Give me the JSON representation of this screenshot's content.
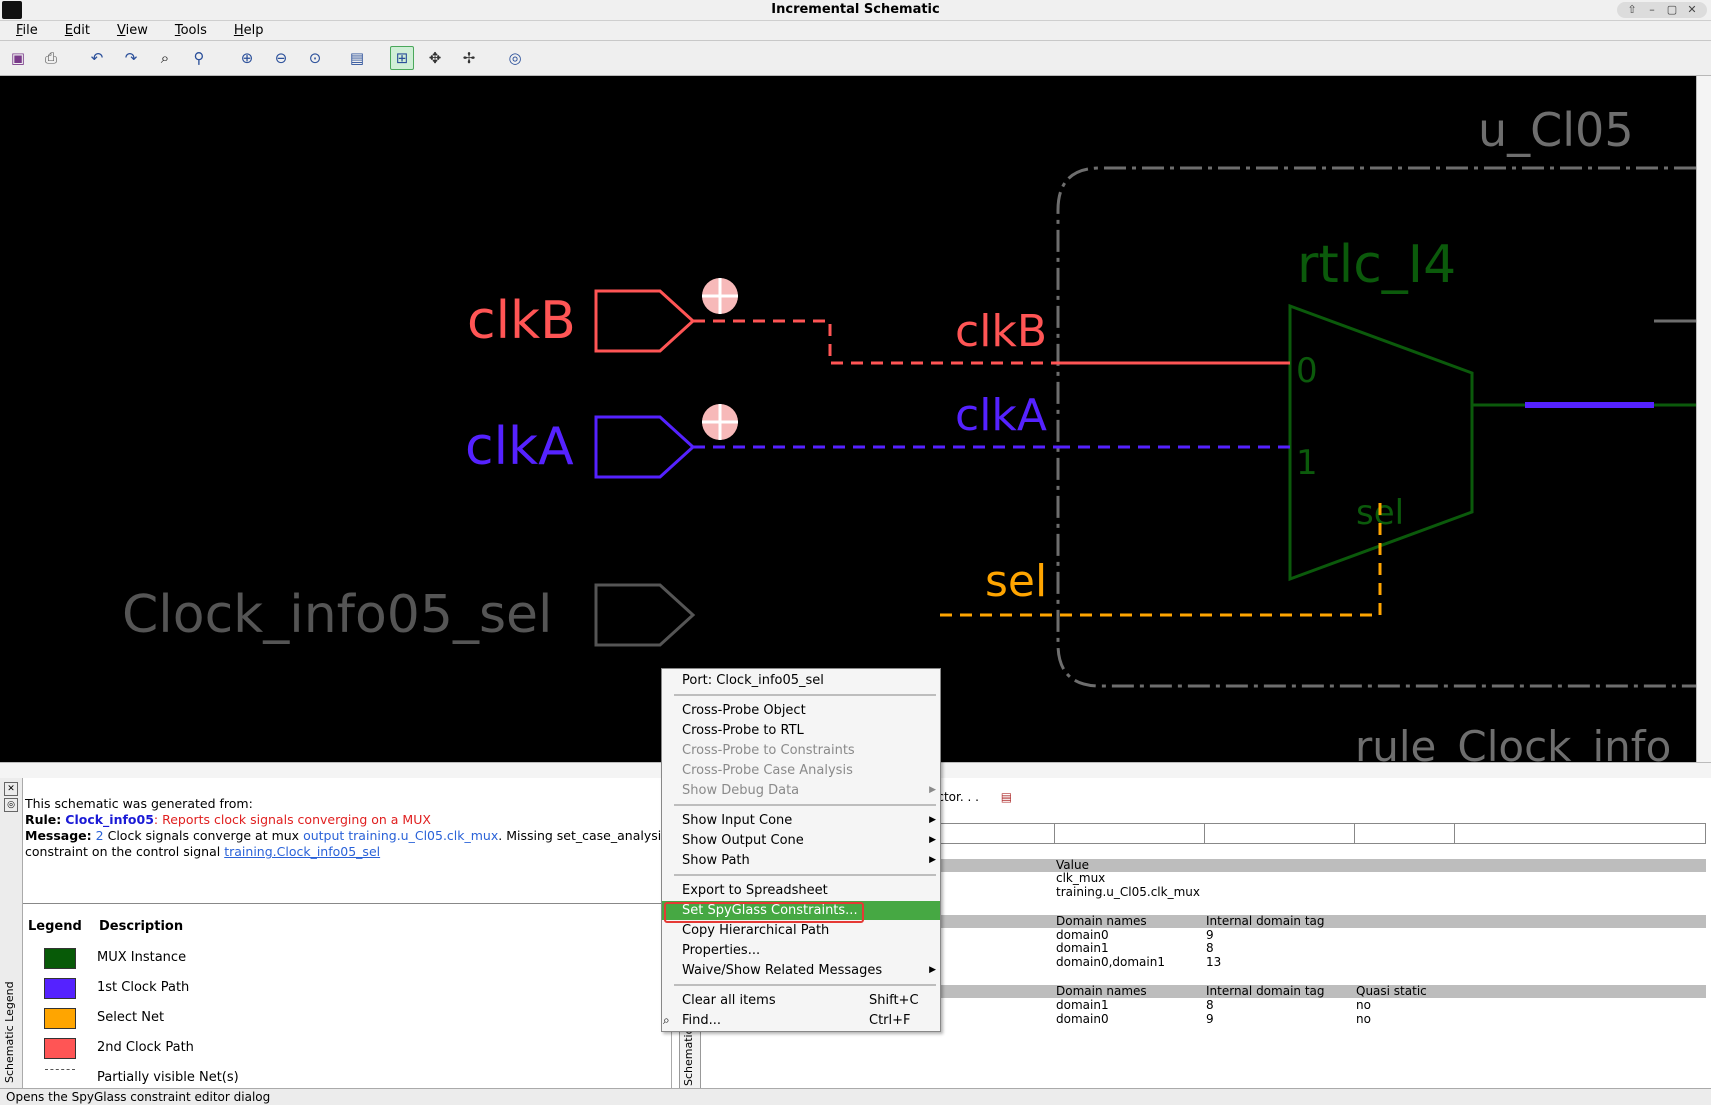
{
  "window": {
    "title": "Incremental Schematic"
  },
  "menubar": [
    "File",
    "Edit",
    "View",
    "Tools",
    "Help"
  ],
  "window_controls": [
    "⇧",
    "–",
    "▢",
    "✕"
  ],
  "toolbar": {
    "icons": [
      "save-icon",
      "print-icon",
      "undo-icon",
      "redo-icon",
      "find-icon",
      "trace-icon",
      "zoom-in-icon",
      "zoom-out-icon",
      "zoom-fit-icon",
      "properties-icon",
      "select-mode-icon",
      "pan-icon",
      "expand-icon",
      "refresh-icon"
    ]
  },
  "schematic": {
    "block_label": "u_Cl05",
    "mux_label": "rtlc_I4",
    "rule_label": "rule_Clock_info",
    "mux_pins": {
      "in0": "0",
      "in1": "1",
      "sel": "sel"
    },
    "ports": [
      {
        "name": "clkB",
        "color": "#ff5555"
      },
      {
        "name": "clkA",
        "color": "#5522ff"
      },
      {
        "name": "Clock_info05_sel",
        "color": "#555555"
      }
    ],
    "nets": [
      {
        "name": "clkB",
        "color": "#ff5555"
      },
      {
        "name": "clkA",
        "color": "#5522ff"
      },
      {
        "name": "sel",
        "color": "#ffa500"
      }
    ],
    "mux_color": "#0b4d0b",
    "block_color": "#6e6e6e"
  },
  "info": {
    "generated_from": "This schematic was generated from:",
    "rule_label": "Rule:",
    "rule_name": "Clock_info05",
    "rule_desc": ": Reports clock signals converging on a MUX",
    "message_label": "Message:",
    "count": "2",
    "msg_part1": "Clock signals converge at mux",
    "msg_link1": "output training.u_Cl05.clk_mux",
    "msg_part2": ". Missing set_case_analysis",
    "msg_part3": "constraint on the control signal",
    "msg_link2": "training.Clock_info05_sel"
  },
  "legend": {
    "header_legend": "Legend",
    "header_desc": "Description",
    "items": [
      {
        "label": "MUX Instance",
        "color": "#075a07"
      },
      {
        "label": "1st Clock Path",
        "color": "#5522ff"
      },
      {
        "label": "Select Net",
        "color": "#ffa500"
      },
      {
        "label": "2nd Clock Path",
        "color": "#ff5555"
      },
      {
        "label": "Partially visible Net(s)",
        "color": "#555555"
      }
    ],
    "tab_label": "Schematic Legend"
  },
  "inspector": {
    "label": "ector. . .",
    "tab_label": "Schematic",
    "section1": {
      "headers": [
        "Value"
      ],
      "rows": [
        [
          "clk_mux"
        ],
        [
          "training.u_Cl05.clk_mux"
        ]
      ]
    },
    "section2": {
      "headers": [
        "Domain names",
        "Internal domain tag"
      ],
      "rows": [
        [
          "domain0",
          "9"
        ],
        [
          "domain1",
          "8"
        ],
        [
          "domain0,domain1",
          "13"
        ]
      ]
    },
    "section3": {
      "headers": [
        "Domain names",
        "Internal domain tag",
        "Quasi static"
      ],
      "rows": [
        [
          "domain1",
          "8",
          "no"
        ],
        [
          "domain0",
          "9",
          "no"
        ]
      ]
    }
  },
  "context_menu": {
    "title": "Port: Clock_info05_sel",
    "items": [
      {
        "label": "Cross-Probe Object",
        "disabled": false
      },
      {
        "label": "Cross-Probe to RTL",
        "disabled": false
      },
      {
        "label": "Cross-Probe to Constraints",
        "disabled": true
      },
      {
        "label": "Cross-Probe Case Analysis",
        "disabled": true
      },
      {
        "label": "Show Debug Data",
        "disabled": true,
        "submenu": true
      },
      {
        "label": "Show Input Cone",
        "submenu": true
      },
      {
        "label": "Show Output Cone",
        "submenu": true
      },
      {
        "label": "Show Path",
        "submenu": true
      },
      {
        "label": "Export to Spreadsheet"
      },
      {
        "label": "Set SpyGlass Constraints...",
        "highlighted": true
      },
      {
        "label": "Copy Hierarchical Path"
      },
      {
        "label": "Properties..."
      },
      {
        "label": "Waive/Show Related Messages",
        "submenu": true
      },
      {
        "label": "Clear all items",
        "shortcut": "Shift+C"
      },
      {
        "label": "Find...",
        "shortcut": "Ctrl+F"
      }
    ]
  },
  "status": "Opens the SpyGlass constraint editor dialog"
}
